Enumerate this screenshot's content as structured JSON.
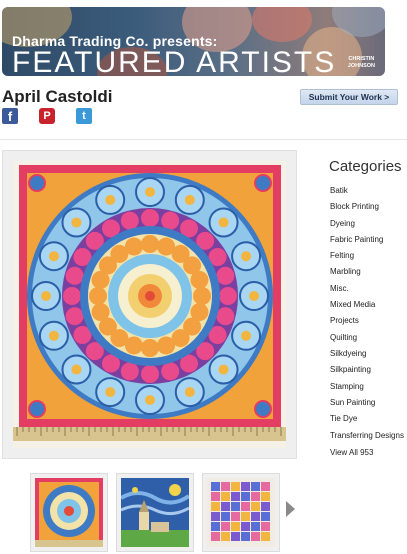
{
  "banner": {
    "line1": "Dharma Trading Co. presents:",
    "line2": "FEATURED ARTISTS",
    "credit_line1": "CHRISTIN",
    "credit_line2": "JOHNSON"
  },
  "artist": {
    "name": "April Castoldi"
  },
  "submit_label": "Submit Your Work >",
  "social": {
    "facebook_glyph": "f",
    "pinterest_glyph": "P",
    "twitter_glyph": "t"
  },
  "icons": [
    "facebook-icon",
    "pinterest-icon",
    "twitter-icon",
    "next-arrow-icon"
  ],
  "colors": {
    "facebook": "#3b5a9a",
    "pinterest": "#c8232c",
    "twitter": "#3a9ad9",
    "submit_bg": "#c4d4ea"
  },
  "categories": {
    "title": "Categories",
    "items": [
      "Batik",
      "Block Printing",
      "Dyeing",
      "Fabric Painting",
      "Felting",
      "Marbling",
      "Misc.",
      "Mixed Media",
      "Projects",
      "Quilting",
      "Silkdyeing",
      "Silkpainting",
      "Stamping",
      "Sun Painting",
      "Tie Dye",
      "Transferring Designs",
      "View All 953"
    ]
  }
}
